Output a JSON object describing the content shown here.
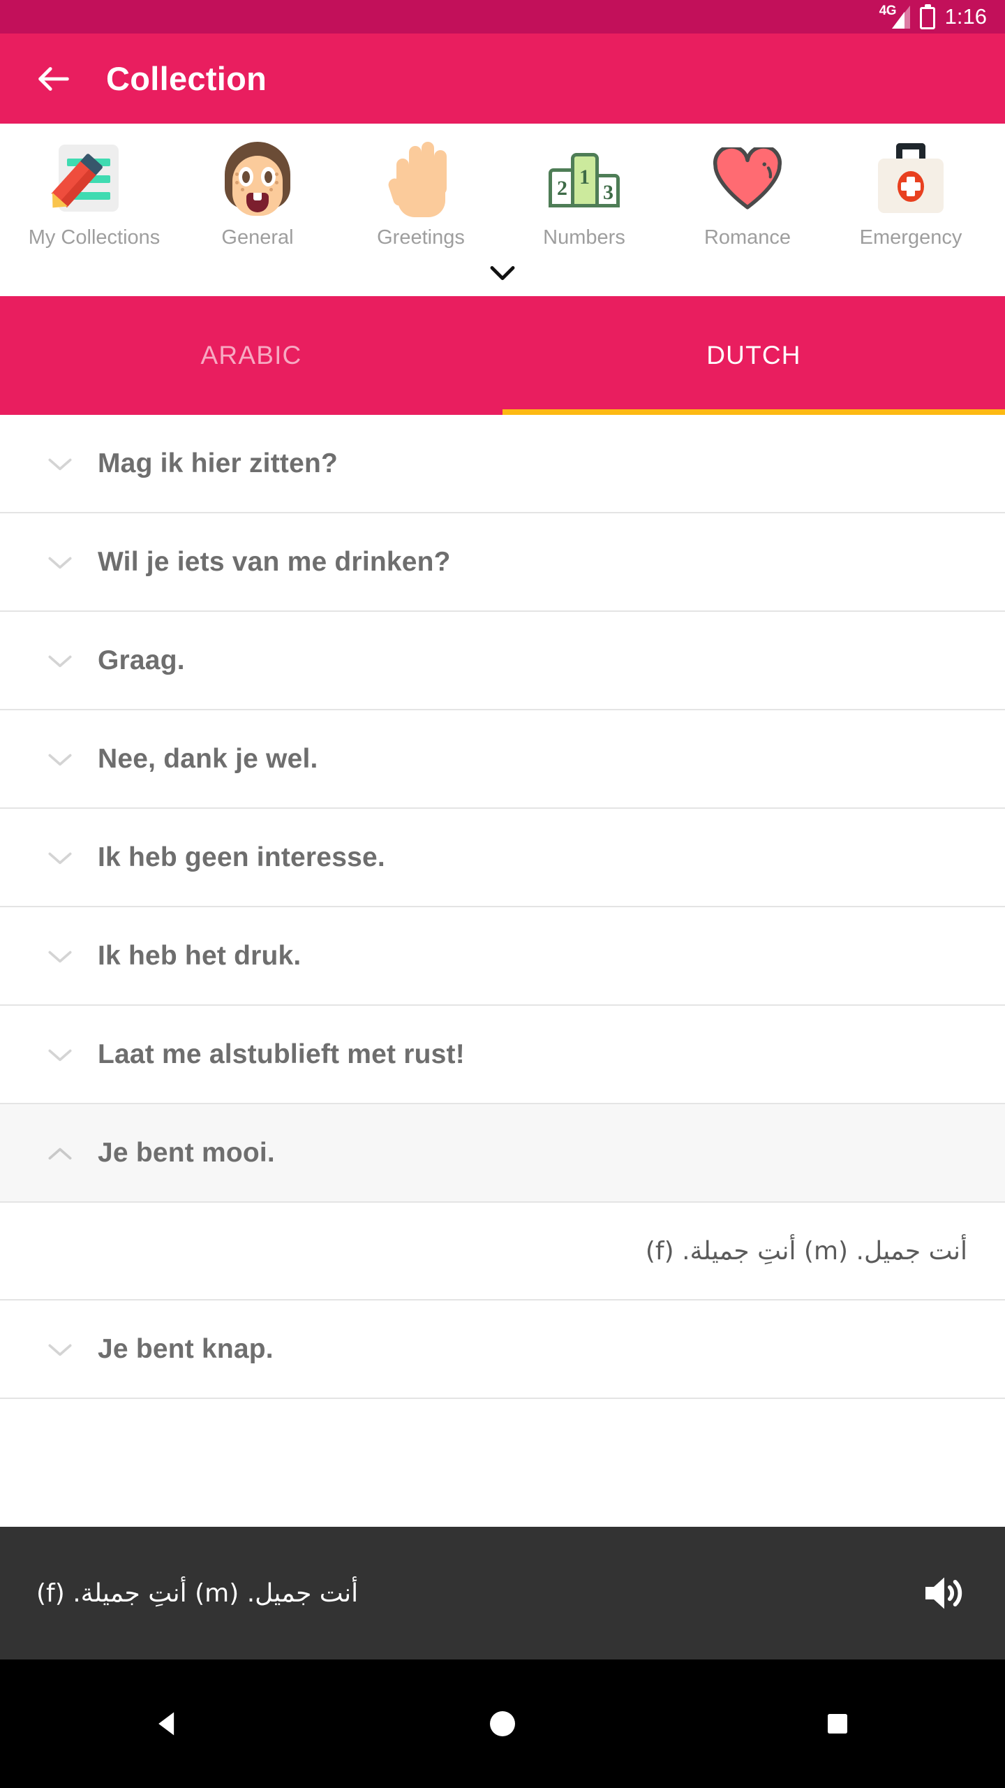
{
  "status_bar": {
    "network": "4G",
    "time": "1:16",
    "battery_icon": "battery-charging-icon",
    "signal_icon": "signal-bars-icon"
  },
  "app_bar": {
    "back_icon": "arrow-left-icon",
    "title": "Collection"
  },
  "categories": {
    "expand_icon": "chevron-down-icon",
    "items": [
      {
        "label": "My Collections",
        "icon": "notepad-pencil-icon"
      },
      {
        "label": "General",
        "icon": "face-icon"
      },
      {
        "label": "Greetings",
        "icon": "raised-hand-icon"
      },
      {
        "label": "Numbers",
        "icon": "podium-icon"
      },
      {
        "label": "Romance",
        "icon": "heart-icon"
      },
      {
        "label": "Emergency",
        "icon": "first-aid-kit-icon"
      }
    ]
  },
  "language_tabs": {
    "tabs": [
      {
        "label": "ARABIC",
        "active": false
      },
      {
        "label": "DUTCH",
        "active": true
      }
    ],
    "indicator_color": "#fdb913"
  },
  "phrases": [
    {
      "text": "Mag ik hier zitten?",
      "expanded": false,
      "chevron": "chevron-down-icon"
    },
    {
      "text": "Wil je iets van me drinken?",
      "expanded": false,
      "chevron": "chevron-down-icon"
    },
    {
      "text": "Graag.",
      "expanded": false,
      "chevron": "chevron-down-icon"
    },
    {
      "text": "Nee, dank je wel.",
      "expanded": false,
      "chevron": "chevron-down-icon"
    },
    {
      "text": "Ik heb geen interesse.",
      "expanded": false,
      "chevron": "chevron-down-icon"
    },
    {
      "text": "Ik heb het druk.",
      "expanded": false,
      "chevron": "chevron-down-icon"
    },
    {
      "text": "Laat me alstublieft met rust!",
      "expanded": false,
      "chevron": "chevron-down-icon"
    },
    {
      "text": "Je bent mooi.",
      "expanded": true,
      "chevron": "chevron-up-icon",
      "translation": "أنت جميل. (m)  أنتِ جميلة. (f)"
    },
    {
      "text": "Je bent knap.",
      "expanded": false,
      "chevron": "chevron-down-icon"
    }
  ],
  "player": {
    "text": "أنت جميل. (m)  أنتِ جميلة. (f)",
    "speaker_icon": "volume-speaker-icon"
  },
  "nav_bar": {
    "back": "triangle-back-icon",
    "home": "circle-home-icon",
    "recents": "square-recents-icon"
  },
  "colors": {
    "status_bar": "#c2105a",
    "app_bar": "#e91e5f",
    "accent": "#fdb913",
    "player_bar": "#333333"
  }
}
